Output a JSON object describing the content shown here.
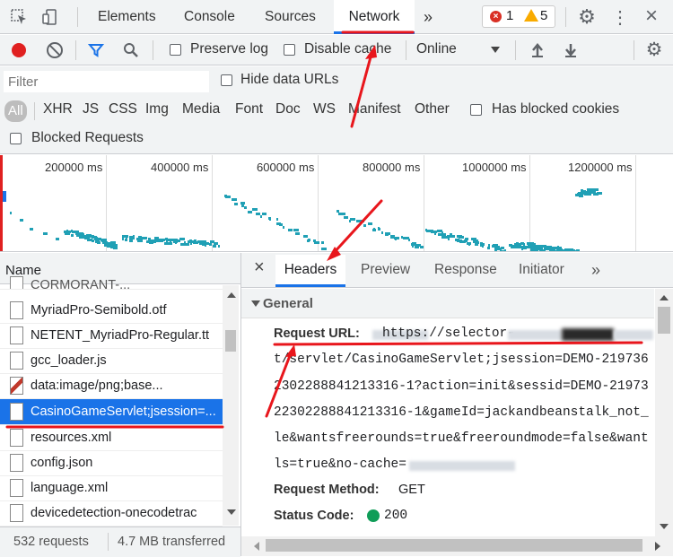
{
  "main_tabs": {
    "elements": "Elements",
    "console": "Console",
    "sources": "Sources",
    "network": "Network",
    "more": "»"
  },
  "badges": {
    "errors": "1",
    "warnings": "5"
  },
  "toolbar": {
    "preserve_log": "Preserve log",
    "disable_cache": "Disable cache",
    "throttle": "Online"
  },
  "filter": {
    "placeholder": "Filter",
    "hide_data_urls": "Hide data URLs",
    "types": [
      "All",
      "XHR",
      "JS",
      "CSS",
      "Img",
      "Media",
      "Font",
      "Doc",
      "WS",
      "Manifest",
      "Other"
    ],
    "has_blocked_cookies": "Has blocked cookies",
    "blocked_requests": "Blocked Requests"
  },
  "timeline": {
    "ticks": [
      "200000 ms",
      "400000 ms",
      "600000 ms",
      "800000 ms",
      "1000000 ms",
      "1200000 ms"
    ]
  },
  "request_list": {
    "header": "Name",
    "items": [
      "CORMORANT-...",
      "MyriadPro-Semibold.otf",
      "NETENT_MyriadPro-Regular.tt",
      "gcc_loader.js",
      "data:image/png;base...",
      "CasinoGameServlet;jsession=...",
      "resources.xml",
      "config.json",
      "language.xml",
      "devicedetection-onecodetrac"
    ],
    "selected_index": 5
  },
  "status_bar": {
    "requests": "532 requests",
    "transferred": "4.7 MB transferred"
  },
  "detail_tabs": {
    "close": "×",
    "headers": "Headers",
    "preview": "Preview",
    "response": "Response",
    "initiator": "Initiator",
    "more": "»"
  },
  "general": {
    "section_title": "General",
    "request_url_label": "Request URL:",
    "request_url_lines": [
      "https://selector-",
      "t/servlet/CasinoGameServlet;jsession=DEMO-219736",
      "2302288841213316-1?action=init&sessid=DEMO-21973",
      "22302288841213316-1&gameId=jackandbeanstalk_not_",
      "le&wantsfreerounds=true&freeroundmode=false&want",
      "ls=true&no-cache="
    ],
    "request_method_label": "Request Method:",
    "request_method_value": "GET",
    "status_code_label": "Status Code:",
    "status_code_value": "200"
  },
  "colors": {
    "accent": "#1a73e8",
    "selected_row": "#1a73e8",
    "annotation": "#e8161c",
    "timeline_dots": "#20a0b5",
    "status_ok": "#0f9d58",
    "error_red": "#d93025",
    "warning_yellow": "#f9ab00"
  }
}
